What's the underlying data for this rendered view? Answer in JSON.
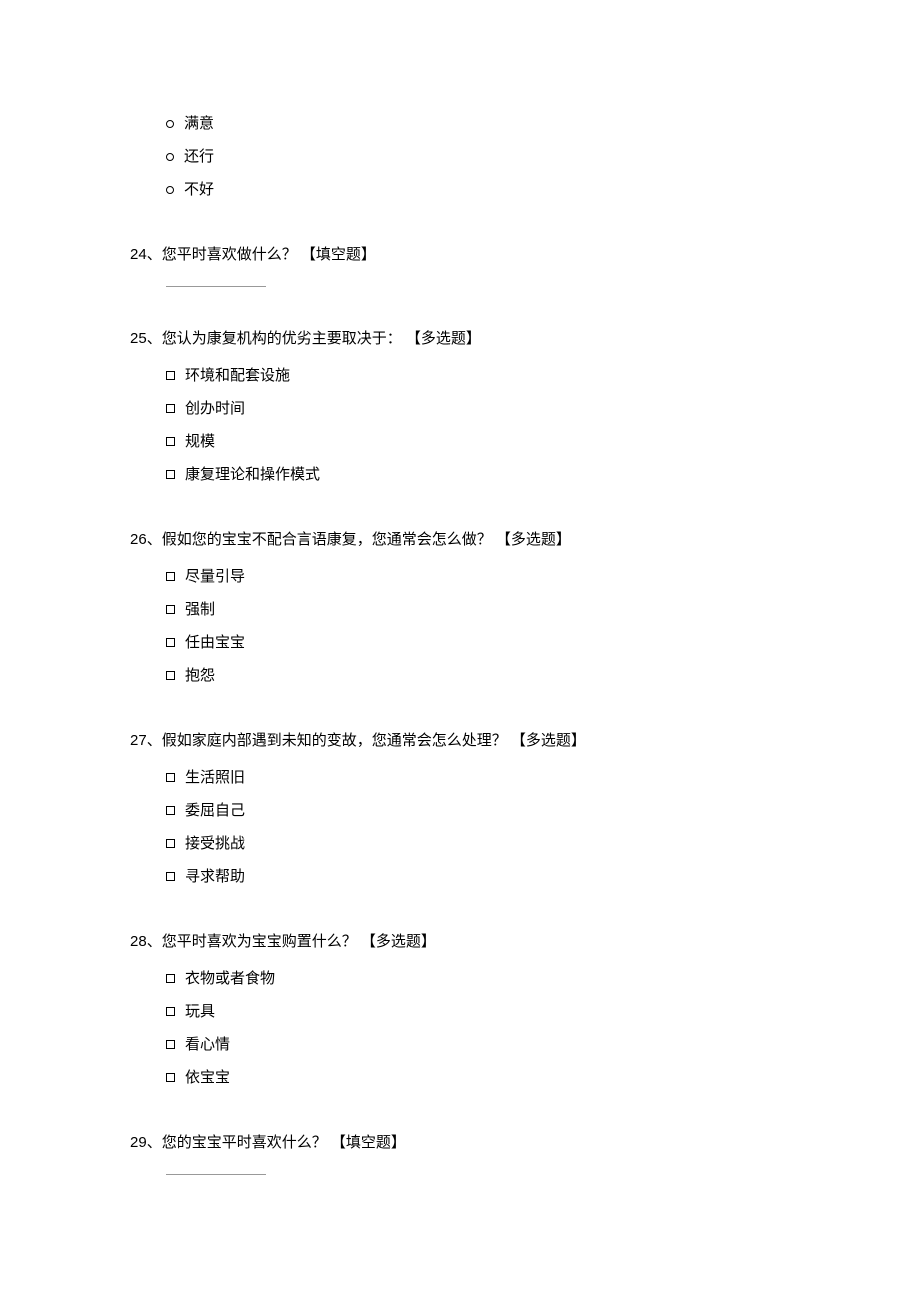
{
  "q23_orphan_options": [
    "满意",
    "还行",
    "不好"
  ],
  "questions": [
    {
      "number": "24",
      "text": "您平时喜欢做什么？",
      "type_label": "【填空题】",
      "type": "fill"
    },
    {
      "number": "25",
      "text": "您认为康复机构的优劣主要取决于：",
      "type_label": "【多选题】",
      "type": "multi",
      "options": [
        "环境和配套设施",
        "创办时间",
        "规模",
        "康复理论和操作模式"
      ]
    },
    {
      "number": "26",
      "text": "假如您的宝宝不配合言语康复，您通常会怎么做？",
      "type_label": "【多选题】",
      "type": "multi",
      "options": [
        "尽量引导",
        "强制",
        "任由宝宝",
        "抱怨"
      ]
    },
    {
      "number": "27",
      "text": "假如家庭内部遇到未知的变故，您通常会怎么处理？",
      "type_label": "【多选题】",
      "type": "multi",
      "options": [
        "生活照旧",
        "委屈自己",
        "接受挑战",
        "寻求帮助"
      ]
    },
    {
      "number": "28",
      "text": "您平时喜欢为宝宝购置什么？",
      "type_label": "【多选题】",
      "type": "multi",
      "options": [
        "衣物或者食物",
        "玩具",
        "看心情",
        "依宝宝"
      ]
    },
    {
      "number": "29",
      "text": "您的宝宝平时喜欢什么？",
      "type_label": "【填空题】",
      "type": "fill"
    }
  ]
}
